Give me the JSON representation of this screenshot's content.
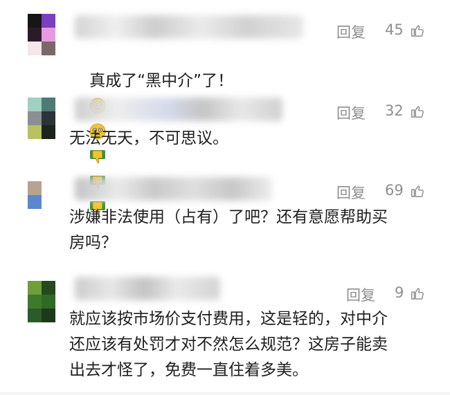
{
  "comments": [
    {
      "reply_label": "回复",
      "likes": "45",
      "text": "真成了“黑中介”了！",
      "emojis": [
        "flushed-face",
        "flushed-face",
        "thumbs-down",
        "thumbs-down",
        "thumbs-down"
      ]
    },
    {
      "reply_label": "回复",
      "likes": "32",
      "text": "无法无天，不可思议。"
    },
    {
      "reply_label": "回复",
      "likes": "69",
      "text": "涉嫌非法使用（占有）了吧？还有意愿帮助买\n房吗？"
    },
    {
      "reply_label": "回复",
      "likes": "9",
      "text": "就应该按市场价支付费用，这是轻的，对中介\n还应该有处罚才对不然怎么规范？这房子能卖\n出去才怪了，免费一直住着多美。"
    }
  ],
  "colors": {
    "meta_gray": "#8e8e8e",
    "text_dark": "#1e1e1e",
    "emoji_yellow": "#f4c430",
    "thumb_green": "#2f9a3a"
  }
}
